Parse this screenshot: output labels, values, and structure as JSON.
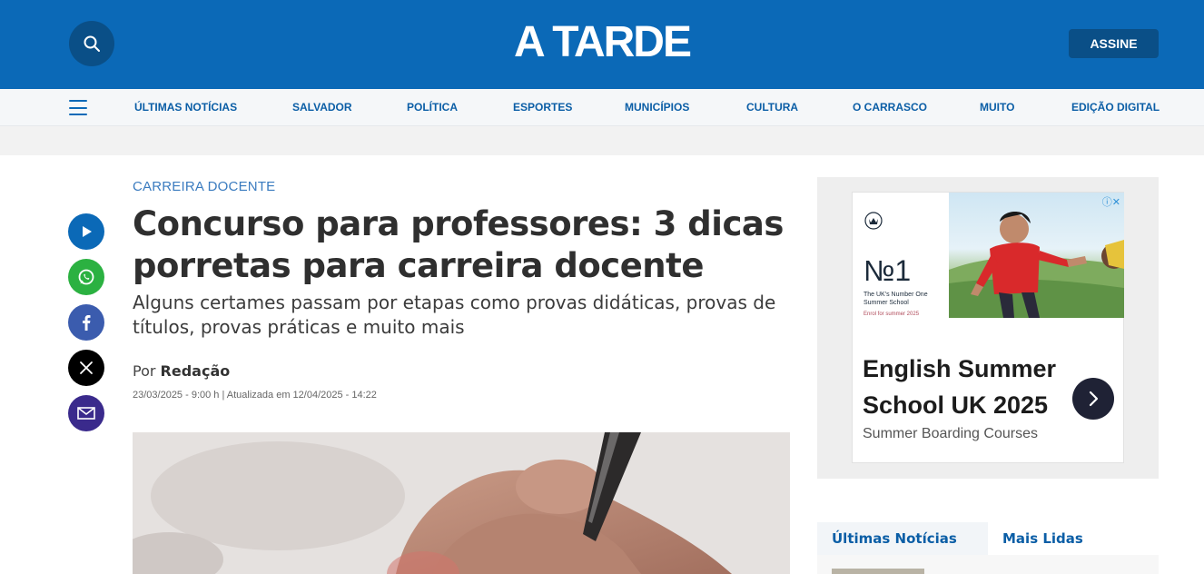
{
  "header": {
    "logo": "A TARDE",
    "subscribe_label": "ASSINE",
    "brand_color": "#0b69b7"
  },
  "nav": {
    "items": [
      "ÚLTIMAS NOTÍCIAS",
      "SALVADOR",
      "POLÍTICA",
      "ESPORTES",
      "MUNICÍPIOS",
      "CULTURA",
      "O CARRASCO",
      "MUITO",
      "EDIÇÃO DIGITAL"
    ]
  },
  "share": {
    "icons": [
      "play-icon",
      "whatsapp-icon",
      "facebook-icon",
      "x-icon",
      "email-icon"
    ]
  },
  "article": {
    "kicker": "CARREIRA DOCENTE",
    "headline": "Concurso para professores: 3 dicas porretas para carreira docente",
    "subhead": "Alguns certames passam por etapas como provas didáticas, provas de títulos, provas práticas e muito mais",
    "byline_prefix": "Por",
    "author": "Redação",
    "dateline": "23/03/2025 - 9:00 h | Atualizada em 12/04/2025 - 14:22"
  },
  "ad": {
    "number_one": "№1",
    "tagline": "The UK's Number One Summer School",
    "enrol": "Enrol for summer 2025",
    "title": "English Summer School UK 2025",
    "subtitle": "Summer Boarding Courses"
  },
  "tabs": {
    "latest": "Últimas Notícias",
    "most_read": "Mais Lidas"
  }
}
